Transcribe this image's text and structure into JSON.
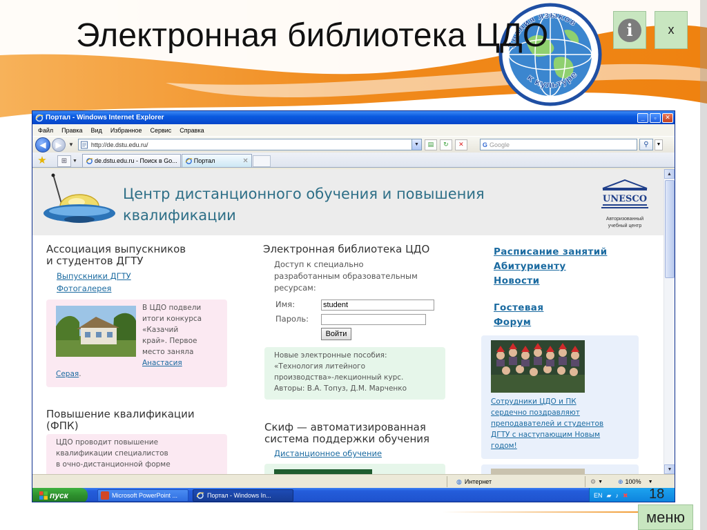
{
  "slide": {
    "title": "Электронная библиотека ЦДО",
    "logo_text_top": "Знания языков",
    "logo_text_bottom": "к культуре",
    "close_label": "x",
    "page_number": "18",
    "menu_label": "меню",
    "colors": {
      "orange": "#f08a1c",
      "button_green": "#c8e6c0"
    }
  },
  "browser": {
    "title": "Портал - Windows Internet Explorer",
    "menu": [
      "Файл",
      "Правка",
      "Вид",
      "Избранное",
      "Сервис",
      "Справка"
    ],
    "address": "http://de.dstu.edu.ru/",
    "search_placeholder": "Google",
    "tabs": [
      {
        "label": "de.dstu.edu.ru - Поиск в Go...",
        "active": false
      },
      {
        "label": "Портал",
        "active": true
      }
    ],
    "status": {
      "zone": "Интернет",
      "zoom": "100%"
    }
  },
  "page": {
    "site_title_line1": "Центр дистанционного обучения и повышения",
    "site_title_line2": "квалификации",
    "unesco": {
      "name": "UNESCO",
      "caption_line1": "Авторизованный",
      "caption_line2": "учебный центр"
    },
    "left": {
      "assoc_heading_line1": "Ассоциация выпускников",
      "assoc_heading_line2": "и студентов ДГТУ",
      "link_graduates": "Выпускники ДГТУ",
      "link_gallery": "Фотогалерея",
      "contest_lines": [
        "В ЦДО подвели",
        "итоги конкурса",
        "«Казачий",
        "край». Первое",
        "место заняла"
      ],
      "contest_link_1": "Анастасия",
      "contest_link_2": "Серая",
      "contest_end": ".",
      "fpk_heading_line1": "Повышение квалификации",
      "fpk_heading_line2": "(ФПК)",
      "fpk_lines": [
        "ЦДО проводит повышение",
        "квалификации специалистов",
        "в очно-дистанционной форме"
      ]
    },
    "middle": {
      "heading": "Электронная библиотека ЦДО",
      "desc_lines": [
        "Доступ к специально",
        "разработанным образовательным",
        "ресурсам:"
      ],
      "login_label": "Имя:",
      "login_value": "student",
      "password_label": "Пароль:",
      "password_value": "",
      "login_button": "Войти",
      "news_lines": [
        "Новые электронные пособия:",
        "«Технология литейного",
        "производства»-лекционный курс.",
        "Авторы: В.А. Топуз, Д.М. Марченко"
      ],
      "skif_heading_line1": "Скиф — автоматизированная",
      "skif_heading_line2": "система поддержки обучения",
      "skif_link": "Дистанционное обучение"
    },
    "right": {
      "links": [
        "Расписание занятий",
        "Абитуриенту",
        "Новости"
      ],
      "links2": [
        "Гостевая",
        "Форум"
      ],
      "news_lines": [
        "Сотрудники ЦДО и ПК",
        "сердечно поздравляют",
        "преподавателей и студентов",
        "ДГТУ с наступающим Новым",
        "годом!"
      ]
    }
  },
  "taskbar": {
    "start": "пуск",
    "items": [
      "Microsoft PowerPoint ...",
      "Портал - Windows In..."
    ],
    "lang": "EN"
  }
}
